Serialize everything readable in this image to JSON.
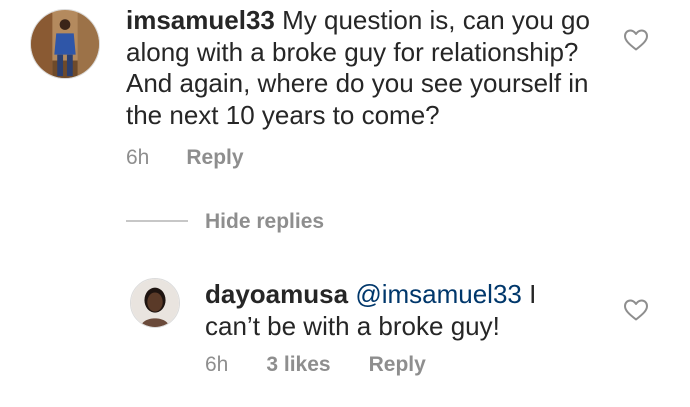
{
  "comment": {
    "username": "imsamuel33",
    "text": "My question is, can you go along with a broke guy for relationship? And again, where do you see yourself in the next 10 years to come?",
    "time": "6h",
    "reply_label": "Reply",
    "like_icon": "heart-outline-icon"
  },
  "hide_replies_label": "Hide replies",
  "reply": {
    "username": "dayoamusa",
    "mention": "@imsamuel33",
    "text": "I can’t be with a broke guy!",
    "time": "6h",
    "likes": "3 likes",
    "reply_label": "Reply",
    "like_icon": "heart-outline-icon"
  },
  "colors": {
    "text": "#262626",
    "muted": "#8e8e8e",
    "mention": "#00376b",
    "divider": "#c7c7c7"
  }
}
